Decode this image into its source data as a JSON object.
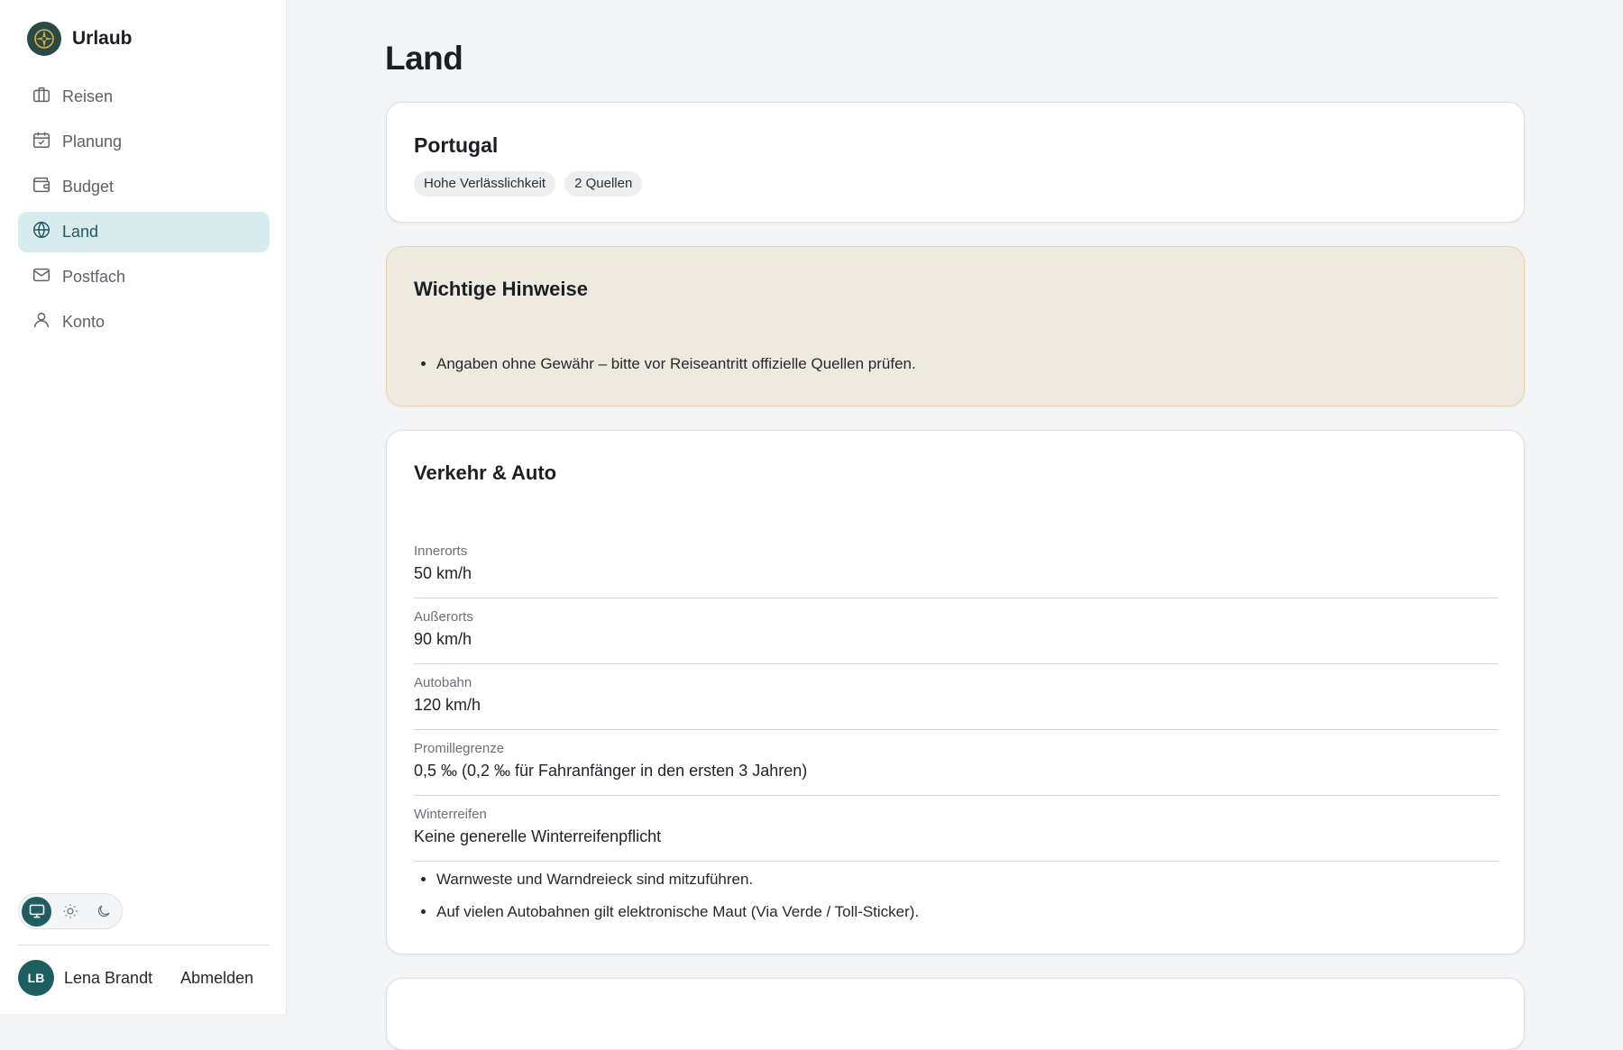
{
  "app": {
    "name": "Urlaub"
  },
  "sidebar": {
    "items": [
      {
        "label": "Reisen",
        "icon": "briefcase-icon",
        "active": false
      },
      {
        "label": "Planung",
        "icon": "calendar-check-icon",
        "active": false
      },
      {
        "label": "Budget",
        "icon": "wallet-icon",
        "active": false
      },
      {
        "label": "Land",
        "icon": "globe-icon",
        "active": true
      },
      {
        "label": "Postfach",
        "icon": "mail-icon",
        "active": false
      },
      {
        "label": "Konto",
        "icon": "user-icon",
        "active": false
      }
    ],
    "theme": {
      "options": [
        "monitor-icon",
        "sun-icon",
        "moon-icon"
      ],
      "selected": "monitor-icon"
    },
    "user": {
      "initials": "LB",
      "name": "Lena Brandt",
      "logout_label": "Abmelden"
    }
  },
  "page": {
    "title": "Land"
  },
  "country_card": {
    "name": "Portugal",
    "badges": [
      "Hohe Verlässlichkeit",
      "2 Quellen"
    ]
  },
  "notes_card": {
    "title": "Wichtige Hinweise",
    "items": [
      "Angaben ohne Gewähr – bitte vor Reiseantritt offizielle Quellen prüfen."
    ]
  },
  "traffic_card": {
    "title": "Verkehr & Auto",
    "rows": [
      {
        "label": "Innerorts",
        "value": "50 km/h"
      },
      {
        "label": "Außerorts",
        "value": "90 km/h"
      },
      {
        "label": "Autobahn",
        "value": "120 km/h"
      },
      {
        "label": "Promillegrenze",
        "value": "0,5 ‰ (0,2 ‰ für Fahranfänger in den ersten 3 Jahren)"
      },
      {
        "label": "Winterreifen",
        "value": "Keine generelle Winterreifenpflicht"
      }
    ],
    "notes": [
      "Warnweste und Warndreieck sind mitzuführen.",
      "Auf vielen Autobahnen gilt elektronische Maut (Via Verde / Toll-Sticker)."
    ]
  },
  "colors": {
    "accent": "#1f5e60",
    "active_nav_bg": "#d8ecee",
    "warning_bg": "#efeae0",
    "warning_border": "#e5d4ae"
  }
}
